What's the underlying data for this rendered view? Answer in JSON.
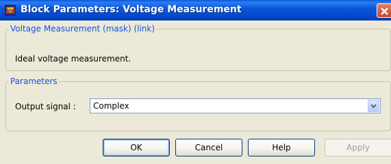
{
  "window": {
    "title": "Block Parameters: Voltage Measurement"
  },
  "mask_group": {
    "legend": "Voltage Measurement (mask) (link)",
    "description": "Ideal voltage measurement."
  },
  "parameters": {
    "legend": "Parameters",
    "output_signal_label": "Output signal :",
    "output_signal_value": "Complex"
  },
  "buttons": {
    "ok": "OK",
    "cancel": "Cancel",
    "help": "Help",
    "apply": "Apply"
  },
  "icons": {
    "app": "simulink-block-icon",
    "close": "close-icon",
    "dropdown": "chevron-down-icon"
  },
  "colors": {
    "titlebar": "#0a58dd",
    "legend": "#1551d6",
    "dialog_bg": "#ece9d8",
    "close_button": "#c8472a"
  }
}
